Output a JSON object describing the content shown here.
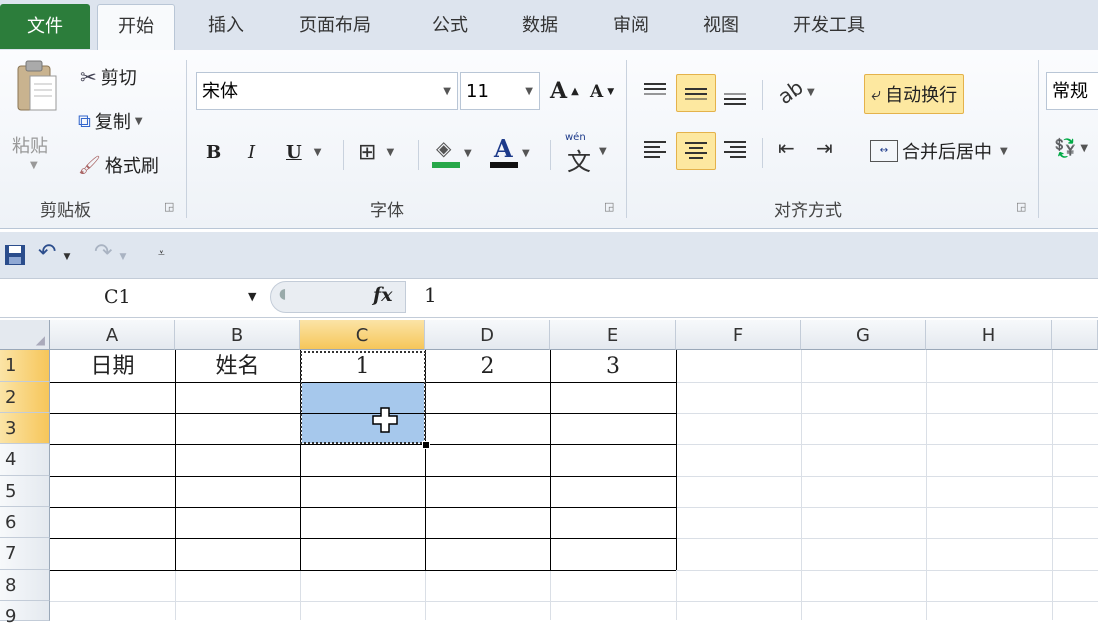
{
  "tabs": {
    "file": "文件",
    "items": [
      "开始",
      "插入",
      "页面布局",
      "公式",
      "数据",
      "审阅",
      "视图",
      "开发工具"
    ],
    "active": "开始"
  },
  "clipboard": {
    "paste": "粘贴",
    "cut": "剪切",
    "copy": "复制",
    "format_painter": "格式刷",
    "group": "剪贴板"
  },
  "font": {
    "name": "宋体",
    "size": "11",
    "bold": "B",
    "italic": "I",
    "underline": "U",
    "font_color_glyph": "A",
    "grow_glyph": "A",
    "shrink_glyph": "A",
    "phonetic_glyph": "wén",
    "phonetic_char": "文",
    "group": "字体"
  },
  "alignment": {
    "wrap_text": "自动换行",
    "merge_center": "合并后居中",
    "group": "对齐方式"
  },
  "number": {
    "format": "常规"
  },
  "formula_bar": {
    "name_box": "C1",
    "fx": "fx",
    "value": "1"
  },
  "sheet": {
    "columns": [
      "A",
      "B",
      "C",
      "D",
      "E",
      "F",
      "G",
      "H"
    ],
    "rows": [
      "1",
      "2",
      "3",
      "4",
      "5",
      "6",
      "7",
      "8",
      "9"
    ],
    "selected_column": "C",
    "cells": {
      "A1": "日期",
      "B1": "姓名",
      "C1": "1",
      "D1": "2",
      "E1": "3"
    }
  }
}
